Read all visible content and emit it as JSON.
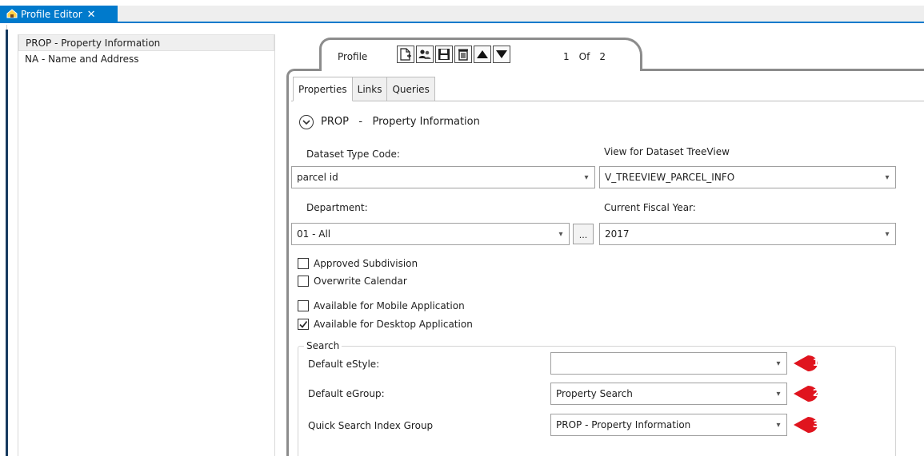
{
  "window": {
    "tab_title": "Profile Editor",
    "close_glyph": "✕"
  },
  "sidebar": {
    "items": [
      {
        "label": "PROP - Property Information"
      },
      {
        "label": "NA - Name and Address"
      }
    ]
  },
  "record_tab": {
    "label": "Profile",
    "pager": {
      "current": "1",
      "of_label": "Of",
      "total": "2"
    },
    "tools": [
      "new-record-icon",
      "users-icon",
      "save-icon",
      "delete-icon",
      "move-up-icon",
      "move-down-icon"
    ]
  },
  "inner_tabs": [
    {
      "label": "Properties"
    },
    {
      "label": "Links"
    },
    {
      "label": "Queries"
    }
  ],
  "section": {
    "code": "PROP",
    "separator": "-",
    "name": "Property Information"
  },
  "fields": {
    "dataset_type_code": {
      "label": "Dataset Type Code:",
      "value": "parcel id"
    },
    "view_for_treeview": {
      "label": "View for Dataset TreeView",
      "value": "V_TREEVIEW_PARCEL_INFO"
    },
    "department": {
      "label": "Department:",
      "value": "01 - All",
      "browse_label": "..."
    },
    "current_fiscal_year": {
      "label": "Current Fiscal Year:",
      "value": "2017"
    }
  },
  "checkboxes": [
    {
      "label": "Approved Subdivision",
      "checked": false
    },
    {
      "label": "Overwrite Calendar",
      "checked": false
    },
    {
      "label": "Available for Mobile Application",
      "checked": false
    },
    {
      "label": "Available for Desktop Application",
      "checked": true
    }
  ],
  "search_group": {
    "title": "Search",
    "rows": [
      {
        "label": "Default eStyle:",
        "value": "",
        "callout": "1"
      },
      {
        "label": "Default eGroup:",
        "value": "Property Search",
        "callout": "2"
      },
      {
        "label": "Quick Search Index Group",
        "value": "PROP - Property Information",
        "callout": "3"
      }
    ]
  },
  "colors": {
    "tab_accent": "#007acc",
    "callout_red": "#e0141e",
    "frame_gray": "#8c8c8c"
  }
}
